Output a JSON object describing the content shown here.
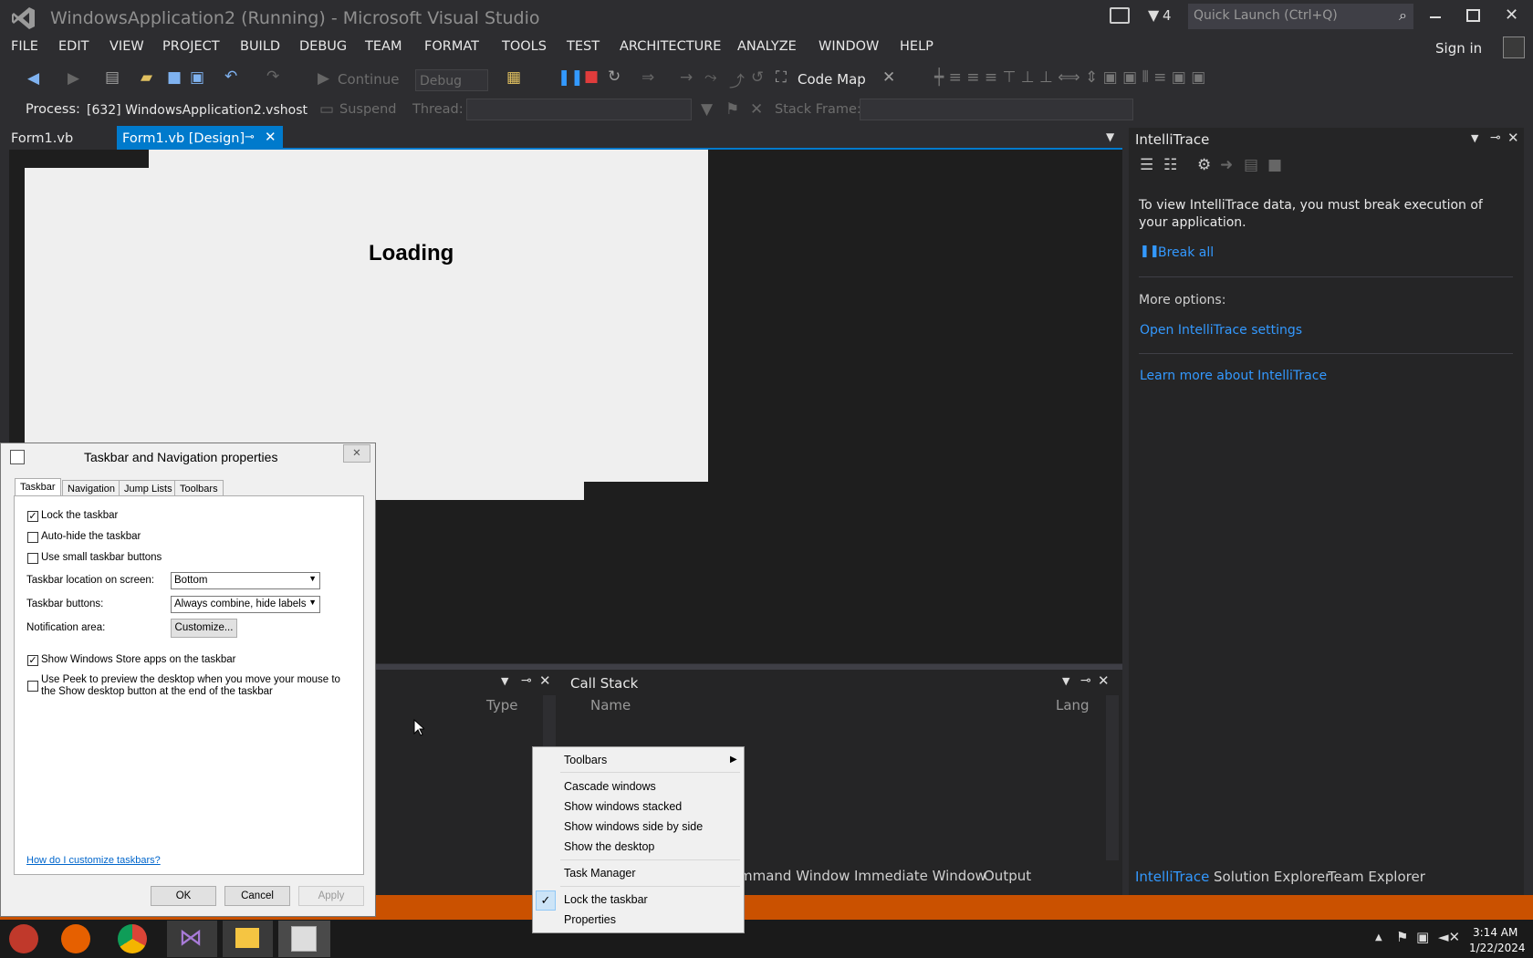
{
  "title": "WindowsApplication2 (Running) - Microsoft Visual Studio",
  "titlebar": {
    "notif_count": "4",
    "quick_launch": "Quick Launch (Ctrl+Q)",
    "sign_in": "Sign in"
  },
  "menu": [
    "FILE",
    "EDIT",
    "VIEW",
    "PROJECT",
    "BUILD",
    "DEBUG",
    "TEAM",
    "FORMAT",
    "TOOLS",
    "TEST",
    "ARCHITECTURE",
    "ANALYZE",
    "WINDOW",
    "HELP"
  ],
  "toolbar": {
    "continue": "Continue",
    "config": "Debug",
    "code_map": "Code Map"
  },
  "debug_bar": {
    "process_label": "Process:",
    "process_value": "[632] WindowsApplication2.vshost",
    "suspend": "Suspend",
    "thread_label": "Thread:",
    "stack_frame_label": "Stack Frame:"
  },
  "tabs": [
    "Form1.vb",
    "Form1.vb [Design]"
  ],
  "designer": {
    "loading_text": "Loading"
  },
  "bottom": {
    "left_col": "Type",
    "callstack_title": "Call Stack",
    "col_name": "Name",
    "col_lang": "Lang",
    "tabs": [
      "mmand Window",
      "Immediate Window",
      "Output"
    ]
  },
  "intellitrace": {
    "title": "IntelliTrace",
    "message": "To view IntelliTrace data, you must break execution of your application.",
    "break_all": "Break all",
    "more_options": "More options:",
    "open_settings": "Open IntelliTrace settings",
    "learn_more": "Learn more about IntelliTrace",
    "bottom_tabs": [
      "IntelliTrace",
      "Solution Explorer",
      "Team Explorer"
    ]
  },
  "dialog": {
    "title": "Taskbar and Navigation properties",
    "tabs": [
      "Taskbar",
      "Navigation",
      "Jump Lists",
      "Toolbars"
    ],
    "lock": "Lock the taskbar",
    "autohide": "Auto-hide the taskbar",
    "small_buttons": "Use small taskbar buttons",
    "location_label": "Taskbar location on screen:",
    "location_value": "Bottom",
    "buttons_label": "Taskbar buttons:",
    "buttons_value": "Always combine, hide labels",
    "notif_label": "Notification area:",
    "customize": "Customize...",
    "store_apps": "Show Windows Store apps on the taskbar",
    "peek": "Use Peek to preview the desktop when you move your mouse to the Show desktop button at the end of the taskbar",
    "help_link": "How do I customize taskbars?",
    "ok": "OK",
    "cancel": "Cancel",
    "apply": "Apply",
    "checked": {
      "lock": true,
      "autohide": false,
      "small_buttons": false,
      "store_apps": true,
      "peek": false
    }
  },
  "context_menu": [
    "Toolbars",
    "Cascade windows",
    "Show windows stacked",
    "Show windows side by side",
    "Show the desktop",
    "Task Manager",
    "Lock the taskbar",
    "Properties"
  ],
  "clock": {
    "time": "3:14 AM",
    "date": "1/22/2024"
  }
}
